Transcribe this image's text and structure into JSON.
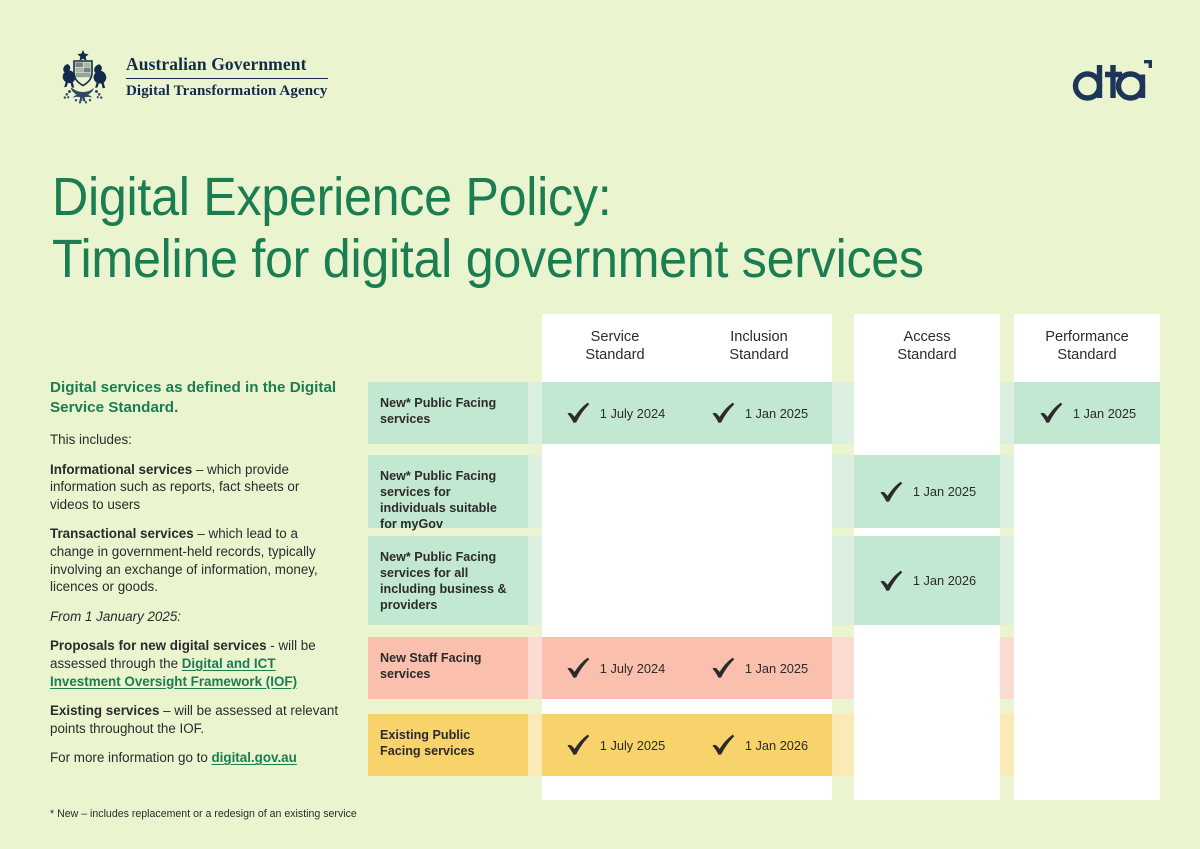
{
  "brand": {
    "coat_of_arms_icon": "australian-coat-of-arms",
    "government_line1": "Australian Government",
    "government_line2": "Digital Transformation Agency",
    "dta_logo_text": "dta",
    "colors": {
      "background": "#eaf4cf",
      "green_accent": "#1b7d52",
      "navy": "#132a4d",
      "cell_green": "#c3e8d1",
      "cell_pink": "#fbbfad",
      "cell_yellow": "#f8d26a",
      "cell_white": "#ffffff"
    }
  },
  "title": {
    "line1": "Digital Experience Policy:",
    "line2": "Timeline for digital government services"
  },
  "sidebar": {
    "heading": "Digital services as defined in the Digital Service Standard.",
    "intro": "This includes:",
    "informational_label": "Informational services",
    "informational_text": " – which provide information such as reports, fact sheets or videos to users",
    "transactional_label": "Transactional services",
    "transactional_text": " – which lead to a change in government-held records, typically involving an exchange of information, money, licences or goods.",
    "from_date": "From 1 January 2025:",
    "proposals_label": "Proposals for new digital services",
    "proposals_text": " - will be assessed through the ",
    "proposals_link": "Digital and ICT Investment Oversight Framework (IOF)",
    "existing_label": "Existing services",
    "existing_text": " – will be assessed at relevant points throughout the IOF.",
    "more_info_text": "For more information go to ",
    "more_info_link": "digital.gov.au"
  },
  "footnote": "* New – includes replacement or a redesign of an existing service",
  "table": {
    "columns": [
      {
        "line1": "Service",
        "line2": "Standard"
      },
      {
        "line1": "Inclusion",
        "line2": "Standard"
      },
      {
        "line1": "Access",
        "line2": "Standard"
      },
      {
        "line1": "Performance",
        "line2": "Standard"
      }
    ],
    "rows": [
      {
        "label": "New* Public Facing services",
        "color": "green",
        "cells": [
          {
            "filled": true,
            "date": "1 July 2024",
            "check_icon": "check-mark-icon"
          },
          {
            "filled": true,
            "date": "1 Jan 2025",
            "check_icon": "check-mark-icon"
          },
          {
            "filled": false,
            "date": "",
            "check_icon": ""
          },
          {
            "filled": true,
            "date": "1 Jan 2025",
            "check_icon": "check-mark-icon"
          }
        ]
      },
      {
        "label": "New* Public Facing services for individuals suitable for myGov",
        "color": "green",
        "cells": [
          {
            "filled": false,
            "date": "",
            "check_icon": ""
          },
          {
            "filled": false,
            "date": "",
            "check_icon": ""
          },
          {
            "filled": true,
            "date": "1 Jan 2025",
            "check_icon": "check-mark-icon"
          },
          {
            "filled": false,
            "date": "",
            "check_icon": ""
          }
        ]
      },
      {
        "label": "New* Public Facing services for all including business & providers",
        "color": "green",
        "cells": [
          {
            "filled": false,
            "date": "",
            "check_icon": ""
          },
          {
            "filled": false,
            "date": "",
            "check_icon": ""
          },
          {
            "filled": true,
            "date": "1 Jan 2026",
            "check_icon": "check-mark-icon"
          },
          {
            "filled": false,
            "date": "",
            "check_icon": ""
          }
        ]
      },
      {
        "label": "New Staff Facing services",
        "color": "pink",
        "cells": [
          {
            "filled": true,
            "date": "1 July 2024",
            "check_icon": "check-mark-icon"
          },
          {
            "filled": true,
            "date": "1 Jan 2025",
            "check_icon": "check-mark-icon"
          },
          {
            "filled": false,
            "date": "",
            "check_icon": ""
          },
          {
            "filled": false,
            "date": "",
            "check_icon": ""
          }
        ]
      },
      {
        "label": "Existing Public Facing services",
        "color": "yellow",
        "cells": [
          {
            "filled": true,
            "date": "1 July 2025",
            "check_icon": "check-mark-icon"
          },
          {
            "filled": true,
            "date": "1 Jan 2026",
            "check_icon": "check-mark-icon"
          },
          {
            "filled": false,
            "date": "",
            "check_icon": ""
          },
          {
            "filled": false,
            "date": "",
            "check_icon": ""
          }
        ]
      }
    ]
  }
}
